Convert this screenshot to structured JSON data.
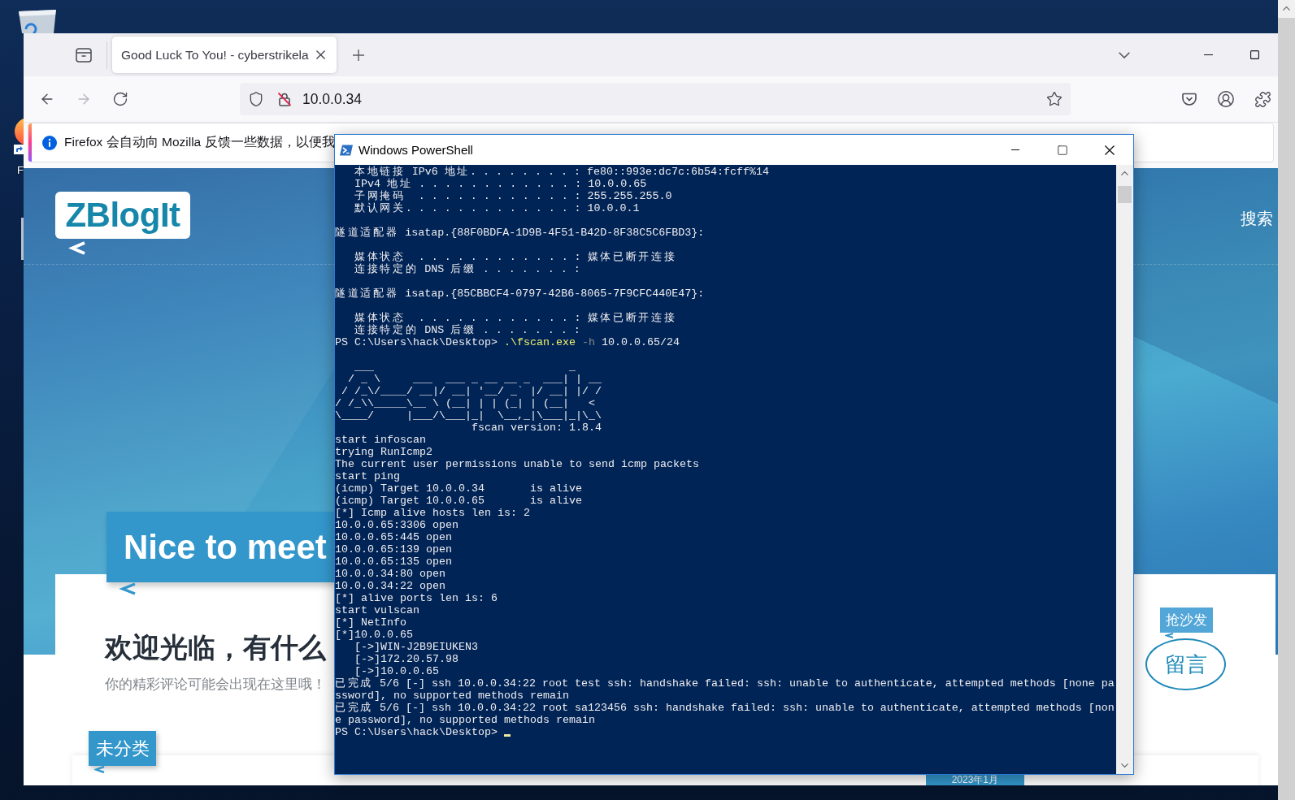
{
  "desktop": {
    "icon_labels": [
      "F"
    ]
  },
  "browser": {
    "tabs": [
      {
        "title": "Good Luck To You! - cyberstrikela",
        "selected": true
      }
    ],
    "navigation": [
      {
        "kind": "back",
        "disabled": false
      },
      {
        "kind": "forward",
        "disabled": true
      },
      {
        "kind": "reload",
        "disabled": false
      }
    ],
    "address": "10.0.0.34",
    "notification": "Firefox 会自动向 Mozilla 反馈一些数据，以便我",
    "page": {
      "logo": "ZBlogIt",
      "search": "搜索",
      "banner": "Nice to meet",
      "heading": "欢迎光临，有什么",
      "subtitle": "你的精彩评论可能会出现在这里哦！",
      "category": "未分类",
      "date": "2023年1月",
      "sofa_tag": "抢沙发",
      "comment_button": "留言"
    }
  },
  "powershell": {
    "title": "Windows PowerShell",
    "lines": [
      {
        "kind": "output",
        "text": "   本地链接 IPv6 地址. . . . . . . . : fe80::993e:dc7c:6b54:fcff%14"
      },
      {
        "kind": "output",
        "text": "   IPv4 地址 . . . . . . . . . . . . : 10.0.0.65"
      },
      {
        "kind": "output",
        "text": "   子网掩码  . . . . . . . . . . . . : 255.255.255.0"
      },
      {
        "kind": "output",
        "text": "   默认网关. . . . . . . . . . . . . : 10.0.0.1"
      },
      {
        "kind": "blank"
      },
      {
        "kind": "output",
        "text": "隧道适配器 isatap.{88F0BDFA-1D9B-4F51-B42D-8F38C5C6FBD3}:"
      },
      {
        "kind": "blank"
      },
      {
        "kind": "output",
        "text": "   媒体状态  . . . . . . . . . . . . : 媒体已断开连接"
      },
      {
        "kind": "output",
        "text": "   连接特定的 DNS 后缀 . . . . . . . :"
      },
      {
        "kind": "blank"
      },
      {
        "kind": "output",
        "text": "隧道适配器 isatap.{85CBBCF4-0797-42B6-8065-7F9CFC440E47}:"
      },
      {
        "kind": "blank"
      },
      {
        "kind": "output",
        "text": "   媒体状态  . . . . . . . . . . . . : 媒体已断开连接"
      },
      {
        "kind": "output",
        "text": "   连接特定的 DNS 后缀 . . . . . . . :"
      },
      {
        "kind": "command",
        "prompt": "PS C:\\Users\\hack\\Desktop>",
        "command": ".\\fscan.exe",
        "parameter": "-h",
        "argument": "10.0.0.65/24"
      },
      {
        "kind": "blank"
      },
      {
        "kind": "output",
        "text": "   ___                              _"
      },
      {
        "kind": "output",
        "text": "  / _ \\     ___  ___ _ __ __ _  ___| | __"
      },
      {
        "kind": "output",
        "text": " / /_\\/____/ __|/ __| '__/ _` |/ __| |/ /"
      },
      {
        "kind": "output",
        "text": "/ /_\\\\_____\\__ \\ (__| | | (_| | (__|   <"
      },
      {
        "kind": "output",
        "text": "\\____/     |___/\\___|_|  \\__,_|\\___|_|\\_\\"
      },
      {
        "kind": "output",
        "text": "                     fscan version: 1.8.4"
      },
      {
        "kind": "output",
        "text": "start infoscan"
      },
      {
        "kind": "output",
        "text": "trying RunIcmp2"
      },
      {
        "kind": "output",
        "text": "The current user permissions unable to send icmp packets"
      },
      {
        "kind": "output",
        "text": "start ping"
      },
      {
        "kind": "output",
        "text": "(icmp) Target 10.0.0.34       is alive"
      },
      {
        "kind": "output",
        "text": "(icmp) Target 10.0.0.65       is alive"
      },
      {
        "kind": "output",
        "text": "[*] Icmp alive hosts len is: 2"
      },
      {
        "kind": "output",
        "text": "10.0.0.65:3306 open"
      },
      {
        "kind": "output",
        "text": "10.0.0.65:445 open"
      },
      {
        "kind": "output",
        "text": "10.0.0.65:139 open"
      },
      {
        "kind": "output",
        "text": "10.0.0.65:135 open"
      },
      {
        "kind": "output",
        "text": "10.0.0.34:80 open"
      },
      {
        "kind": "output",
        "text": "10.0.0.34:22 open"
      },
      {
        "kind": "output",
        "text": "[*] alive ports len is: 6"
      },
      {
        "kind": "output",
        "text": "start vulscan"
      },
      {
        "kind": "output",
        "text": "[*] NetInfo"
      },
      {
        "kind": "output",
        "text": "[*]10.0.0.65"
      },
      {
        "kind": "output",
        "text": "   [->]WIN-J2B9EIUKEN3"
      },
      {
        "kind": "output",
        "text": "   [->]172.20.57.98"
      },
      {
        "kind": "output",
        "text": "   [->]10.0.0.65"
      },
      {
        "kind": "output",
        "text": "已完成 5/6 [-] ssh 10.0.0.34:22 root test ssh: handshake failed: ssh: unable to authenticate, attempted methods [none pa"
      },
      {
        "kind": "output",
        "text": "ssword], no supported methods remain"
      },
      {
        "kind": "output",
        "text": "已完成 5/6 [-] ssh 10.0.0.34:22 root sa123456 ssh: handshake failed: ssh: unable to authenticate, attempted methods [non"
      },
      {
        "kind": "output",
        "text": "e password], no supported methods remain"
      },
      {
        "kind": "prompt",
        "prompt": "PS C:\\Users\\hack\\Desktop>",
        "cursor": true
      }
    ]
  }
}
